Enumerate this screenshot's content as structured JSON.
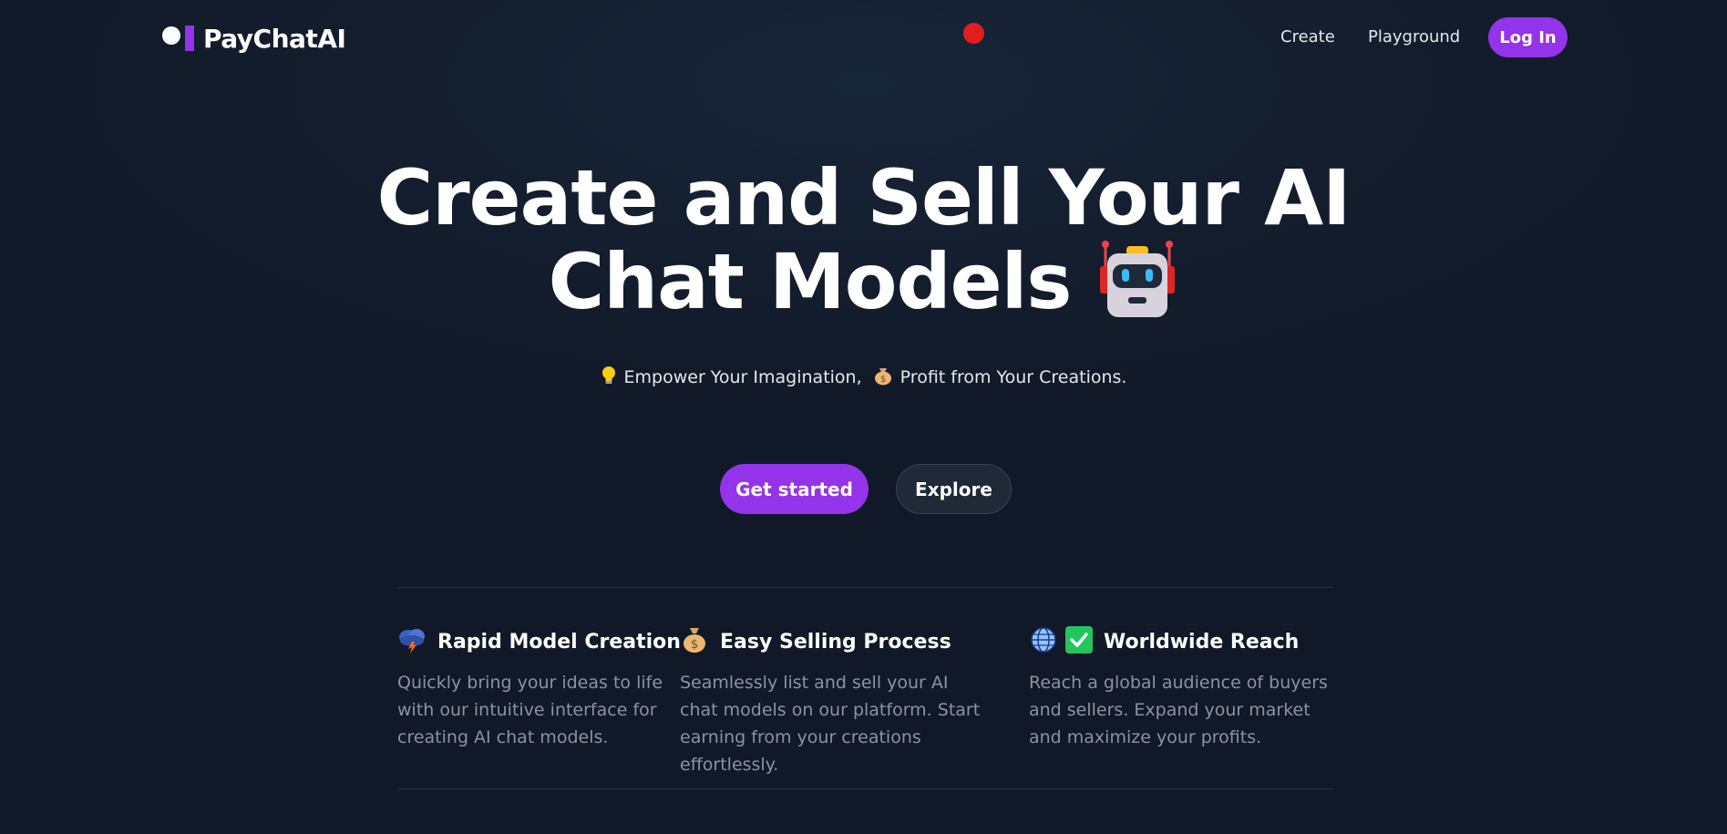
{
  "nav": {
    "brand": "PayChatAI",
    "links": [
      "Create",
      "Playground"
    ],
    "login_label": "Log In"
  },
  "hero": {
    "title_line1": "Create and Sell Your AI",
    "title_line2": "Chat Models",
    "title_emoji_icon": "robot-icon",
    "subtitle_part1": "Empower Your Imagination,",
    "subtitle_part2": "Profit from Your Creations.",
    "subtitle_icons": [
      "lightbulb-icon",
      "money-bag-icon"
    ]
  },
  "cta": {
    "primary_label": "Get started",
    "secondary_label": "Explore"
  },
  "features": [
    {
      "title": "Rapid Model Creation",
      "icon": "lightning-cloud-icon",
      "description": "Quickly bring your ideas to life with our intuitive interface for creating AI chat models."
    },
    {
      "title": "Easy Selling Process",
      "icon": "money-bag-icon",
      "description": "Seamlessly list and sell your AI chat models on our platform. Start earning from your creations effortlessly."
    },
    {
      "title": "Worldwide Reach",
      "icon": "globe-check-icon",
      "description": "Reach a global audience of buyers and sellers. Expand your market and maximize your profits."
    }
  ],
  "colors": {
    "accent": "#9333ea",
    "background": "#111827",
    "muted_text": "#8b93a3",
    "record_dot": "#e11d1d"
  }
}
